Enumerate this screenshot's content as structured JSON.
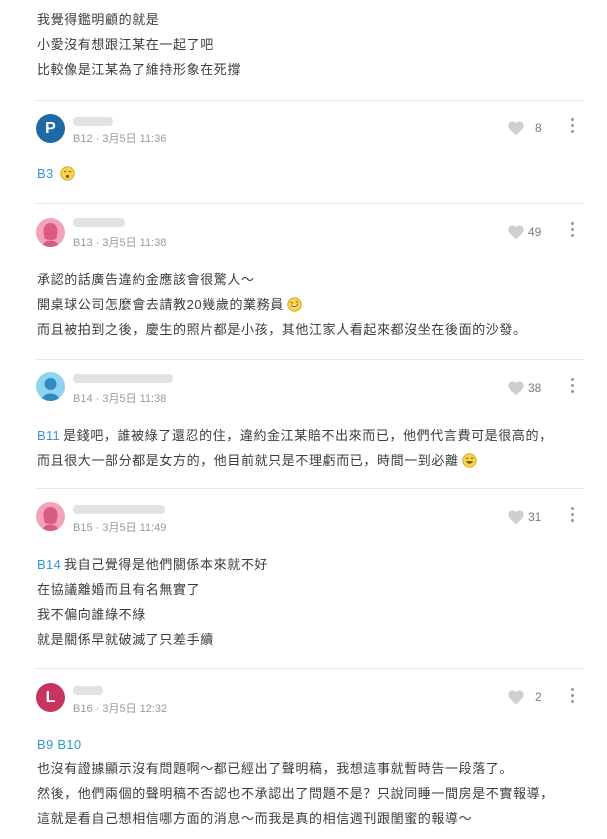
{
  "top_comment": {
    "lines": [
      "我覺得鑑明顧的就是",
      "小愛沒有想跟江某在一起了吧",
      "比較像是江某為了維持形象在死撐"
    ]
  },
  "posts": [
    {
      "avatar_letter": "P",
      "avatar_color": "#1f6aa5",
      "meta": "B12 · 3月5日 11:36",
      "likes": "8",
      "mention": "B3",
      "lines": []
    },
    {
      "avatar_letter": "",
      "avatar_color": "#f3a3b6",
      "meta": "B13 · 3月5日 11:38",
      "likes": "49",
      "mention": "",
      "lines": [
        "承認的話廣告違約金應該會很驚人～",
        "開桌球公司怎麼會去請教20幾歲的業務員",
        "而且被拍到之後，慶生的照片都是小孩，其他江家人看起來都沒坐在後面的沙發。"
      ]
    },
    {
      "avatar_letter": "",
      "avatar_color": "#8fd3f0",
      "meta": "B14 · 3月5日 11:38",
      "likes": "38",
      "mention": "B11",
      "lines": [
        "是錢吧，誰被綠了還忍的住，違約金江某賠不出來而已，他們代言費可是很高的，",
        "而且很大一部分都是女方的，他目前就只是不理虧而已，時間一到必離"
      ]
    },
    {
      "avatar_letter": "",
      "avatar_color": "#f3a3b6",
      "meta": "B15 · 3月5日 11:49",
      "likes": "31",
      "mention": "B14",
      "lines": [
        "我自己覺得是他們關係本來就不好",
        "在協議離婚而且有名無實了",
        "我不偏向誰綠不綠",
        "就是關係早就破滅了只差手續"
      ]
    },
    {
      "avatar_letter": "L",
      "avatar_color": "#c9345f",
      "meta": "B16 · 3月5日 12:32",
      "likes": "2",
      "mention": "B9 B10",
      "lines": [
        "也沒有證據顯示沒有問題啊～都已經出了聲明稿，我想這事就暫時告一段落了。",
        "然後，他們兩個的聲明稿不否認也不承認出了問題不是？只說同睡一間房是不實報導，",
        "這就是看自己想相信哪方面的消息～而我是真的相信週刊跟閨蜜的報導～"
      ]
    }
  ],
  "colors": {
    "mention": "#3397cf",
    "text": "#3c3c3c",
    "meta": "#9a9a9a"
  }
}
